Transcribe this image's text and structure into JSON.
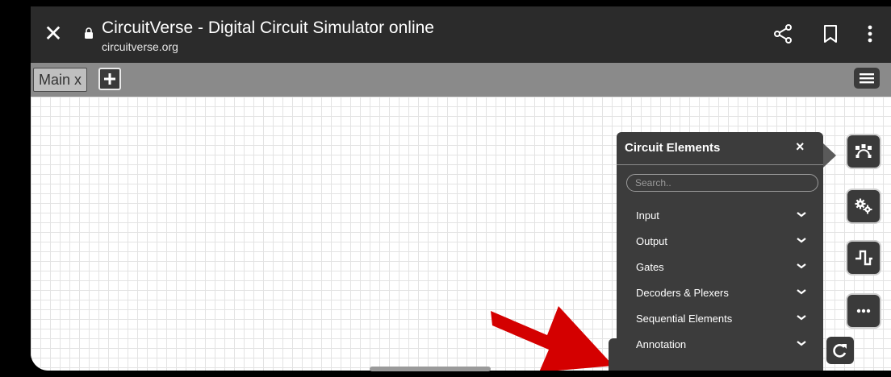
{
  "browser": {
    "title": "CircuitVerse - Digital Circuit Simulator online",
    "url": "circuitverse.org",
    "icons": [
      "close-icon",
      "lock-icon",
      "share-icon",
      "bookmark-icon",
      "more-vert-icon"
    ]
  },
  "tabs": {
    "items": [
      {
        "label": "Main  x"
      }
    ],
    "add_icon": "plus-icon",
    "menu_icon": "hamburger-icon"
  },
  "panel": {
    "title": "Circuit Elements",
    "close_label": "×",
    "search_placeholder": "Search..",
    "categories": [
      {
        "label": "Input"
      },
      {
        "label": "Output"
      },
      {
        "label": "Gates"
      },
      {
        "label": "Decoders & Plexers"
      },
      {
        "label": "Sequential Elements"
      },
      {
        "label": "Annotation"
      }
    ]
  },
  "toolbar": {
    "icons": [
      "bezier-curve-icon",
      "gears-icon",
      "waveform-icon",
      "ellipsis-icon",
      "refresh-icon"
    ]
  },
  "colors": {
    "browser_bar": "#2b2b2b",
    "tab_bar": "#8a8a8a",
    "panel_bg": "#3c3c3c",
    "arrow": "#d40000"
  }
}
